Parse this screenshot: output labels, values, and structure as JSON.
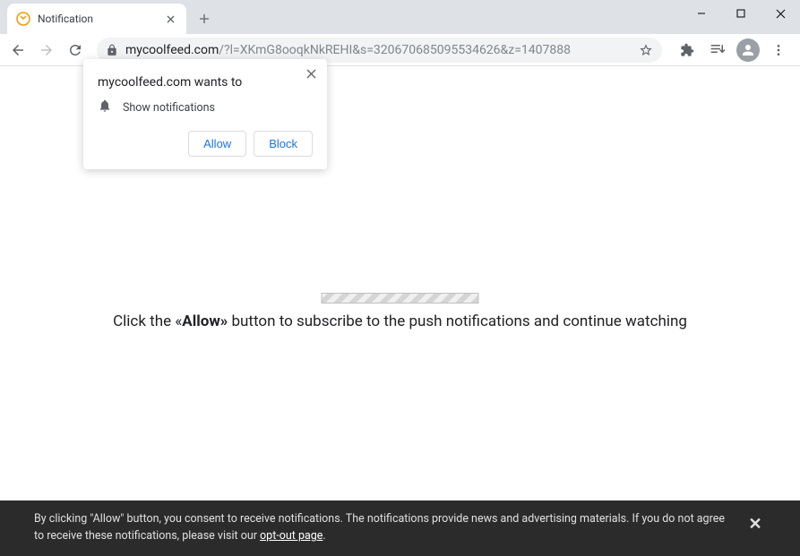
{
  "tab": {
    "title": "Notification"
  },
  "url": {
    "domain": "mycoolfeed.com",
    "path": "/?l=XKmG8ooqkNkREHI&s=320670685095534626&z=1407888"
  },
  "permission": {
    "title": "mycoolfeed.com wants to",
    "row_text": "Show notifications",
    "allow_label": "Allow",
    "block_label": "Block"
  },
  "instruction": {
    "prefix": "Click the «",
    "bold": "Allow»",
    "suffix": " button to subscribe to the push notifications and continue watching"
  },
  "cookie": {
    "text_part1": "By clicking \"Allow\" button, you consent to receive notifications. The notifications provide news and advertising materials. If you do not agree to receive these notifications, please visit our ",
    "link": "opt-out page",
    "text_part2": "."
  }
}
